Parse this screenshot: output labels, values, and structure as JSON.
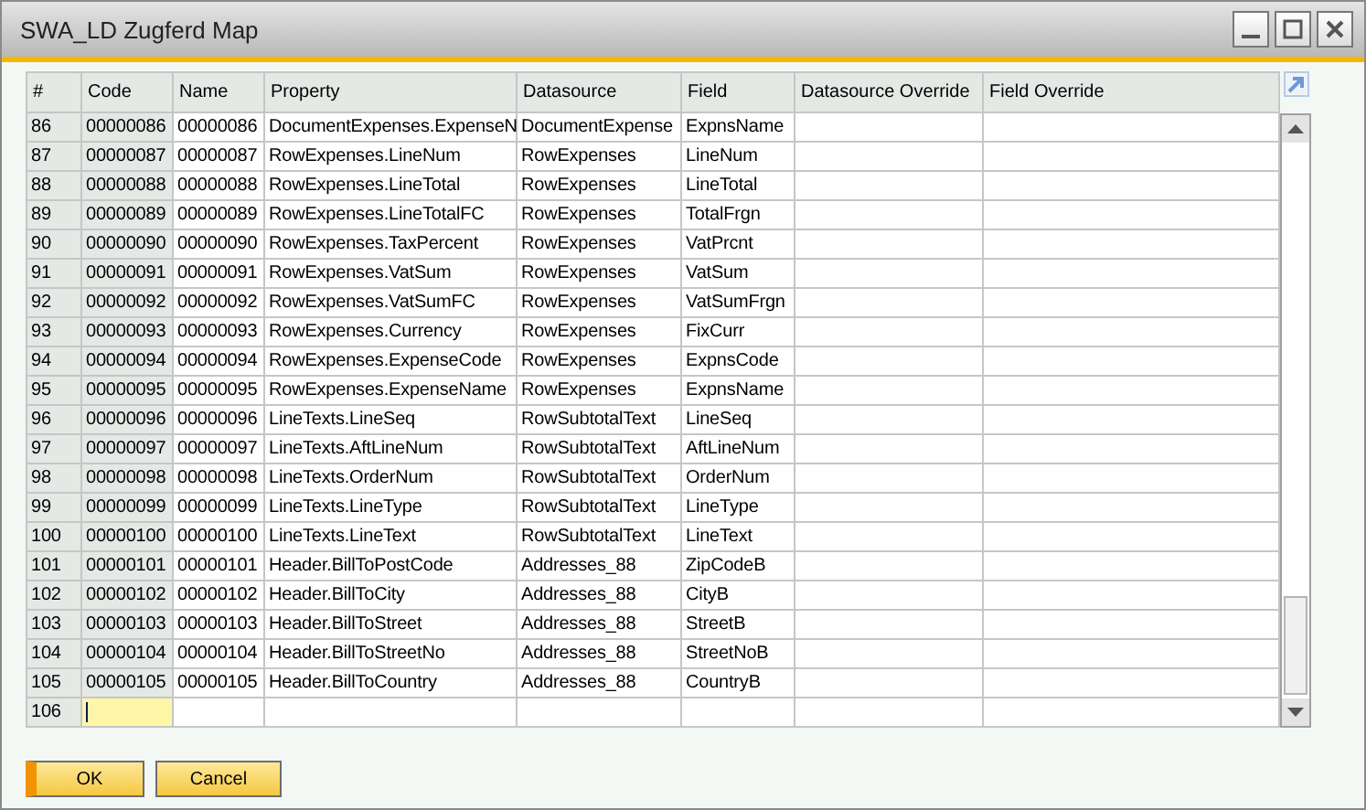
{
  "window": {
    "title": "SWA_LD Zugferd Map"
  },
  "columns": [
    "#",
    "Code",
    "Name",
    "Property",
    "Datasource",
    "Field",
    "Datasource Override",
    "Field Override"
  ],
  "rows": [
    {
      "cells": [
        "86",
        "00000086",
        "00000086",
        "DocumentExpenses.ExpenseN",
        "DocumentExpense",
        "ExpnsName",
        "",
        ""
      ]
    },
    {
      "cells": [
        "87",
        "00000087",
        "00000087",
        "RowExpenses.LineNum",
        "RowExpenses",
        "LineNum",
        "",
        ""
      ]
    },
    {
      "cells": [
        "88",
        "00000088",
        "00000088",
        "RowExpenses.LineTotal",
        "RowExpenses",
        "LineTotal",
        "",
        ""
      ]
    },
    {
      "cells": [
        "89",
        "00000089",
        "00000089",
        "RowExpenses.LineTotalFC",
        "RowExpenses",
        "TotalFrgn",
        "",
        ""
      ]
    },
    {
      "cells": [
        "90",
        "00000090",
        "00000090",
        "RowExpenses.TaxPercent",
        "RowExpenses",
        "VatPrcnt",
        "",
        ""
      ]
    },
    {
      "cells": [
        "91",
        "00000091",
        "00000091",
        "RowExpenses.VatSum",
        "RowExpenses",
        "VatSum",
        "",
        ""
      ]
    },
    {
      "cells": [
        "92",
        "00000092",
        "00000092",
        "RowExpenses.VatSumFC",
        "RowExpenses",
        "VatSumFrgn",
        "",
        ""
      ]
    },
    {
      "cells": [
        "93",
        "00000093",
        "00000093",
        "RowExpenses.Currency",
        "RowExpenses",
        "FixCurr",
        "",
        ""
      ]
    },
    {
      "cells": [
        "94",
        "00000094",
        "00000094",
        "RowExpenses.ExpenseCode",
        "RowExpenses",
        "ExpnsCode",
        "",
        ""
      ]
    },
    {
      "cells": [
        "95",
        "00000095",
        "00000095",
        "RowExpenses.ExpenseName",
        "RowExpenses",
        "ExpnsName",
        "",
        ""
      ]
    },
    {
      "cells": [
        "96",
        "00000096",
        "00000096",
        "LineTexts.LineSeq",
        "RowSubtotalText",
        "LineSeq",
        "",
        ""
      ]
    },
    {
      "cells": [
        "97",
        "00000097",
        "00000097",
        "LineTexts.AftLineNum",
        "RowSubtotalText",
        "AftLineNum",
        "",
        ""
      ]
    },
    {
      "cells": [
        "98",
        "00000098",
        "00000098",
        "LineTexts.OrderNum",
        "RowSubtotalText",
        "OrderNum",
        "",
        ""
      ]
    },
    {
      "cells": [
        "99",
        "00000099",
        "00000099",
        "LineTexts.LineType",
        "RowSubtotalText",
        "LineType",
        "",
        ""
      ]
    },
    {
      "cells": [
        "100",
        "00000100",
        "00000100",
        "LineTexts.LineText",
        "RowSubtotalText",
        "LineText",
        "",
        ""
      ]
    },
    {
      "cells": [
        "101",
        "00000101",
        "00000101",
        "Header.BillToPostCode",
        "Addresses_88",
        "ZipCodeB",
        "",
        ""
      ]
    },
    {
      "cells": [
        "102",
        "00000102",
        "00000102",
        "Header.BillToCity",
        "Addresses_88",
        "CityB",
        "",
        ""
      ]
    },
    {
      "cells": [
        "103",
        "00000103",
        "00000103",
        "Header.BillToStreet",
        "Addresses_88",
        "StreetB",
        "",
        ""
      ]
    },
    {
      "cells": [
        "104",
        "00000104",
        "00000104",
        "Header.BillToStreetNo",
        "Addresses_88",
        "StreetNoB",
        "",
        ""
      ]
    },
    {
      "cells": [
        "105",
        "00000105",
        "00000105",
        "Header.BillToCountry",
        "Addresses_88",
        "CountryB",
        "",
        ""
      ]
    },
    {
      "cells": [
        "106",
        "",
        "",
        "",
        "",
        "",
        "",
        ""
      ],
      "editing": true
    }
  ],
  "buttons": [
    {
      "label": "OK",
      "default": true
    },
    {
      "label": "Cancel",
      "default": false
    }
  ]
}
